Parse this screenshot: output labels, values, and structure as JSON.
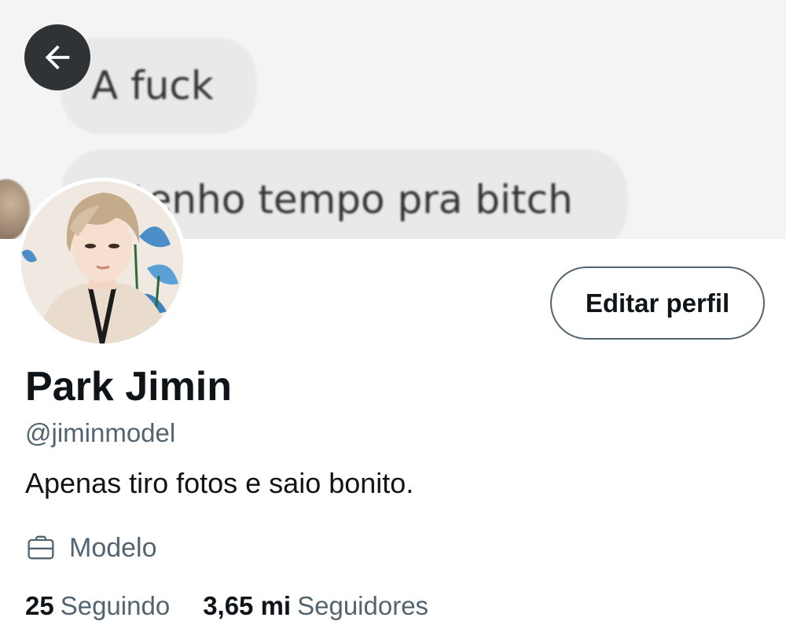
{
  "banner": {
    "message_1": "A fuck",
    "message_2": "tenho tempo pra bitch"
  },
  "header": {
    "back_icon": "arrow-left-icon"
  },
  "profile": {
    "edit_button_label": "Editar perfil",
    "name": "Park Jimin",
    "handle": "@jiminmodel",
    "bio": "Apenas tiro fotos e saio bonito.",
    "job_icon": "briefcase-icon",
    "job": "Modelo"
  },
  "stats": {
    "following_count": "25",
    "following_label": "Seguindo",
    "followers_count": "3,65 mi",
    "followers_label": "Seguidores"
  },
  "colors": {
    "primary_text": "#0f1419",
    "secondary_text": "#536471",
    "back_button_bg": "#2f3336"
  }
}
